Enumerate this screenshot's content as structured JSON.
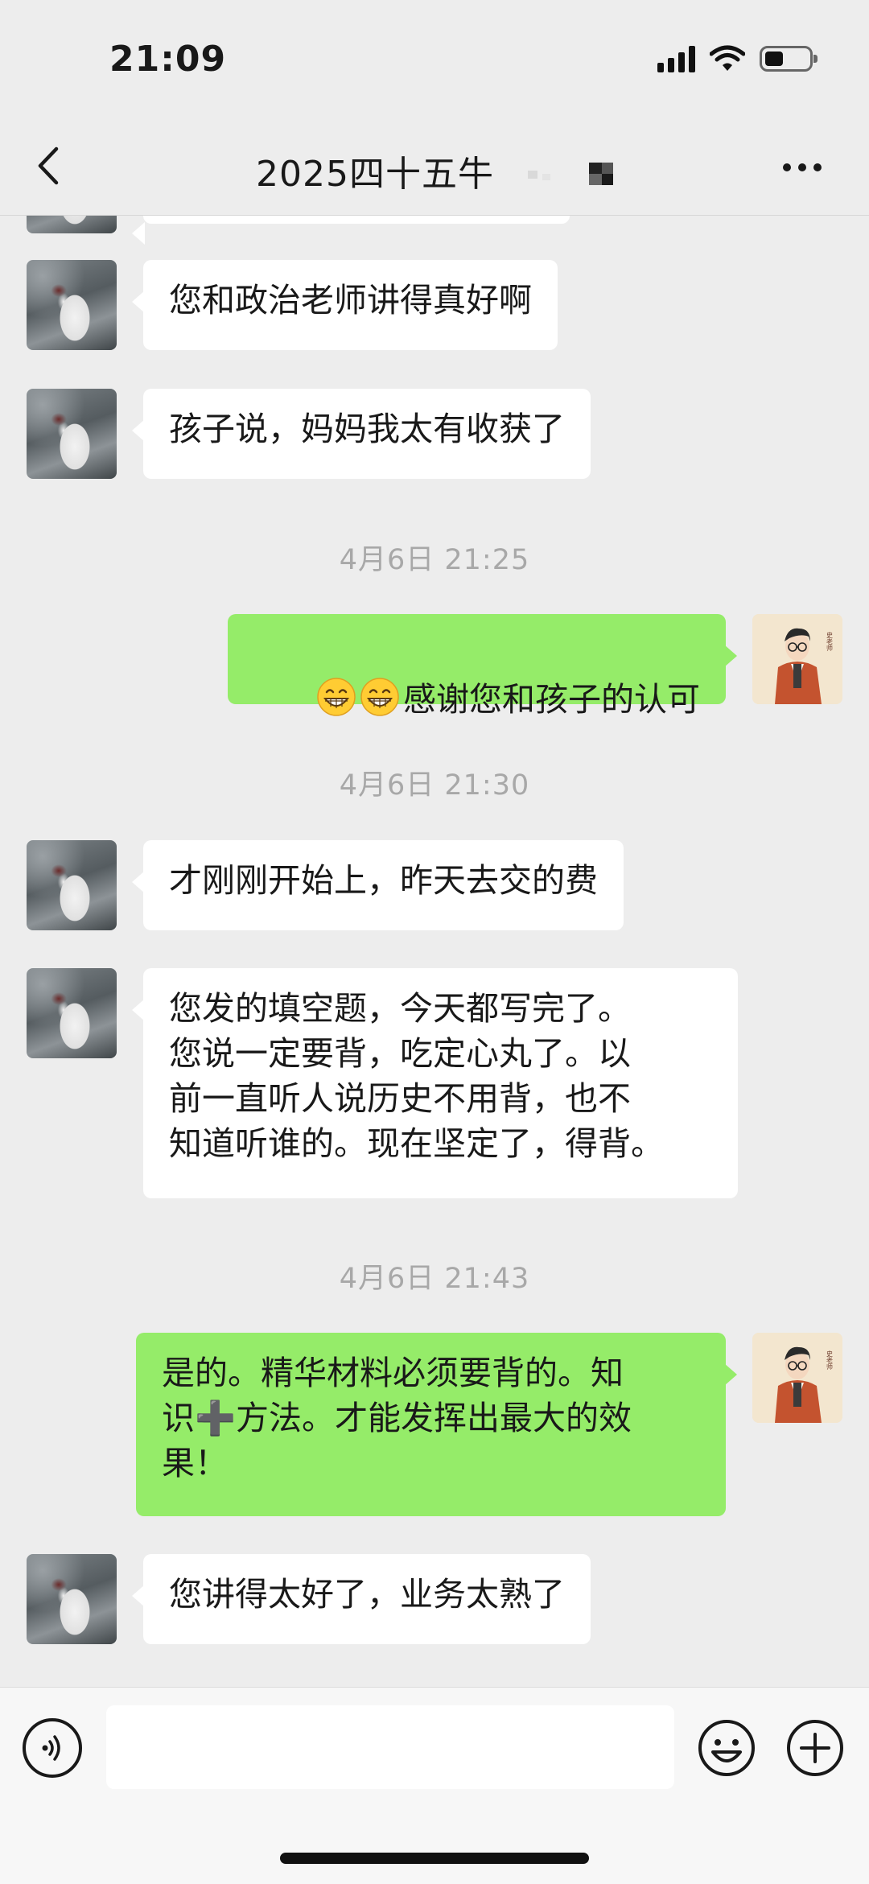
{
  "status_bar": {
    "time": "21:09",
    "icons": [
      "signal-icon",
      "wifi-icon",
      "battery-icon"
    ]
  },
  "nav": {
    "back_icon": "chevron-left-icon",
    "title": "2025四十五牛",
    "title_mosaic": "redacted-mosaic",
    "more_icon": "more-dots-icon"
  },
  "messages": [
    {
      "type": "incoming",
      "text": "您和政治老师讲得真好啊",
      "avatar": "swan-avatar"
    },
    {
      "type": "incoming",
      "text": "孩子说，妈妈我太有收获了",
      "avatar": "swan-avatar"
    },
    {
      "type": "timestamp",
      "text": "4月6日 21:25"
    },
    {
      "type": "outgoing",
      "emoji": [
        "grinning-face-icon",
        "grinning-face-icon"
      ],
      "text": "感谢您和孩子的认可",
      "avatar": "teacher-avatar"
    },
    {
      "type": "timestamp",
      "text": "4月6日 21:30"
    },
    {
      "type": "incoming",
      "text": "才刚刚开始上，昨天去交的费",
      "avatar": "swan-avatar"
    },
    {
      "type": "incoming",
      "text": "您发的填空题，今天都写完了。\n您说一定要背，吃定心丸了。以\n前一直听人说历史不用背，也不\n知道听谁的。现在坚定了，得背。",
      "avatar": "swan-avatar"
    },
    {
      "type": "timestamp",
      "text": "4月6日 21:43"
    },
    {
      "type": "outgoing",
      "text": "是的。精华材料必须要背的。知\n识➕方法。才能发挥出最大的效\n果！",
      "avatar": "teacher-avatar"
    },
    {
      "type": "incoming",
      "text": "您讲得太好了，业务太熟了",
      "avatar": "swan-avatar"
    }
  ],
  "avatar_label": "史老师",
  "input_bar": {
    "voice_icon": "voice-icon",
    "input_value": "",
    "emoji_icon": "emoji-face-icon",
    "plus_icon": "plus-circle-icon"
  },
  "colors": {
    "background": "#ededed",
    "incoming_bubble": "#ffffff",
    "outgoing_bubble": "#95ec69",
    "timestamp_text": "#a8a8a8"
  }
}
